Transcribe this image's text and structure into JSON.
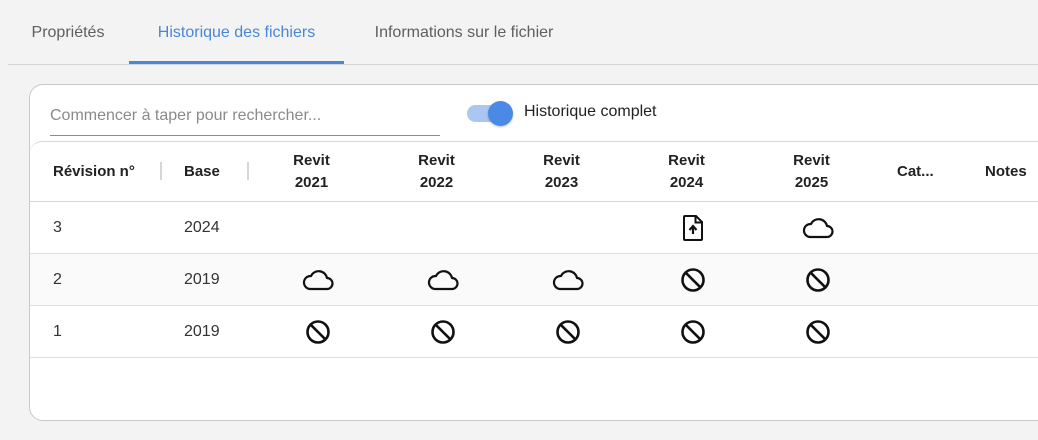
{
  "tabs": [
    {
      "label": "Propriétés",
      "active": false
    },
    {
      "label": "Historique des fichiers",
      "active": true
    },
    {
      "label": "Informations sur le fichier",
      "active": false
    }
  ],
  "search": {
    "placeholder": "Commencer à taper pour rechercher...",
    "value": ""
  },
  "toggle": {
    "label": "Historique complet",
    "on": true
  },
  "table": {
    "columns": {
      "revision": "Révision n°",
      "base": "Base",
      "revit2021": [
        "Revit",
        "2021"
      ],
      "revit2022": [
        "Revit",
        "2022"
      ],
      "revit2023": [
        "Revit",
        "2023"
      ],
      "revit2024": [
        "Revit",
        "2024"
      ],
      "revit2025": [
        "Revit",
        "2025"
      ],
      "category": "Cat...",
      "notes": "Notes"
    },
    "rows": [
      {
        "revision": "3",
        "base": "2024",
        "status": [
          "",
          "",
          "",
          "file-upload-icon",
          "cloud-icon"
        ]
      },
      {
        "revision": "2",
        "base": "2019",
        "status": [
          "cloud-icon",
          "cloud-icon",
          "cloud-icon",
          "block-icon",
          "block-icon"
        ]
      },
      {
        "revision": "1",
        "base": "2019",
        "status": [
          "block-icon",
          "block-icon",
          "block-icon",
          "block-icon",
          "block-icon"
        ]
      }
    ]
  },
  "colors": {
    "accent": "#4a86d8",
    "toggle_track": "#a9c7f0",
    "toggle_knob": "#4a8ae6"
  }
}
